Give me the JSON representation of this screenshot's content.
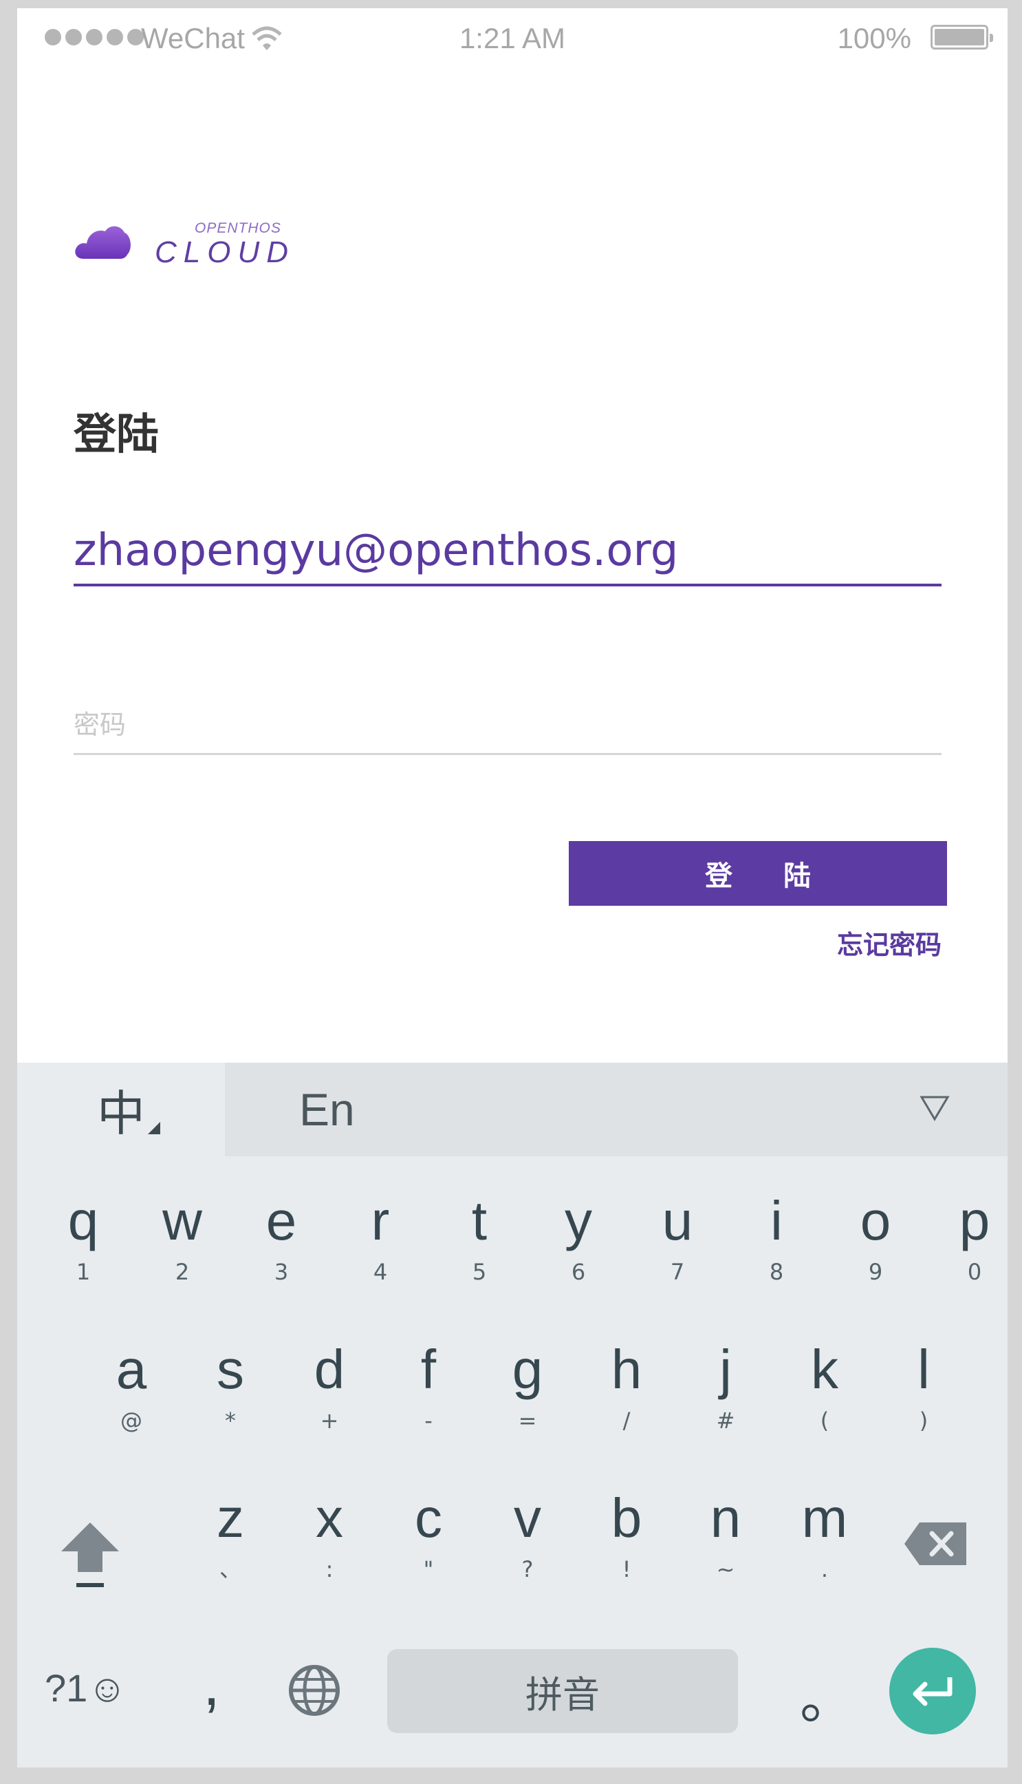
{
  "status_bar": {
    "carrier": "WeChat",
    "time": "1:21 AM",
    "battery": "100%"
  },
  "logo": {
    "small": "OPENTHOS",
    "big": "CLOUD"
  },
  "login": {
    "title": "登陆",
    "email_value": "zhaopengyu@openthos.org",
    "password_placeholder": "密码",
    "login_button": "登 陆",
    "forgot_link": "忘记密码"
  },
  "colors": {
    "accent": "#5c3ba2",
    "enter_key": "#41b7a4"
  },
  "keyboard": {
    "lang_zh": "中",
    "lang_en": "En",
    "collapse_icon": "triangle-down-icon",
    "row1": [
      {
        "main": "q",
        "sub": "1"
      },
      {
        "main": "w",
        "sub": "2"
      },
      {
        "main": "e",
        "sub": "3"
      },
      {
        "main": "r",
        "sub": "4"
      },
      {
        "main": "t",
        "sub": "5"
      },
      {
        "main": "y",
        "sub": "6"
      },
      {
        "main": "u",
        "sub": "7"
      },
      {
        "main": "i",
        "sub": "8"
      },
      {
        "main": "o",
        "sub": "9"
      },
      {
        "main": "p",
        "sub": "0"
      }
    ],
    "row2": [
      {
        "main": "a",
        "sub": "@"
      },
      {
        "main": "s",
        "sub": "*"
      },
      {
        "main": "d",
        "sub": "+"
      },
      {
        "main": "f",
        "sub": "-"
      },
      {
        "main": "g",
        "sub": "="
      },
      {
        "main": "h",
        "sub": "/"
      },
      {
        "main": "j",
        "sub": "#"
      },
      {
        "main": "k",
        "sub": "("
      },
      {
        "main": "l",
        "sub": ")"
      }
    ],
    "row3": [
      {
        "main": "z",
        "sub": "、"
      },
      {
        "main": "x",
        "sub": ":"
      },
      {
        "main": "c",
        "sub": "\""
      },
      {
        "main": "v",
        "sub": "?"
      },
      {
        "main": "b",
        "sub": "!"
      },
      {
        "main": "n",
        "sub": "~"
      },
      {
        "main": "m",
        "sub": "."
      }
    ],
    "symbols_key": "?1☺",
    "comma_key": ",",
    "space_key": "拼音",
    "period_key": "。"
  }
}
